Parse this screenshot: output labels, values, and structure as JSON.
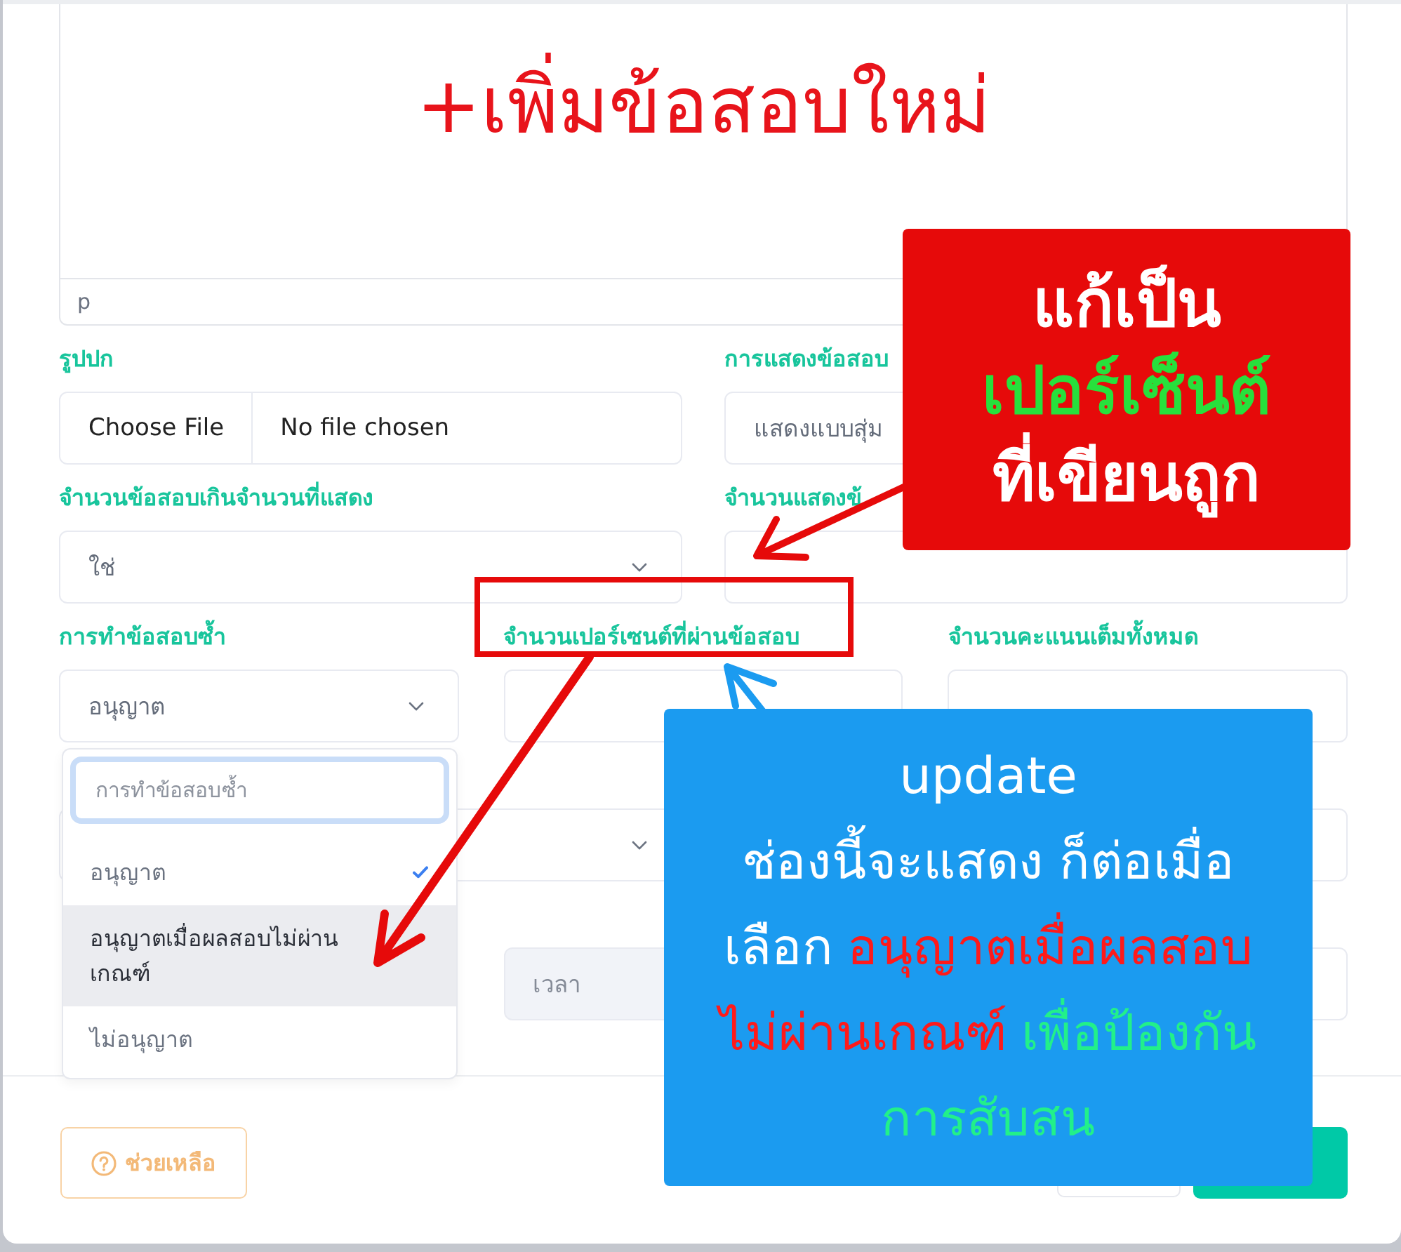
{
  "editor": {
    "heading": "+เพิ่มข้อสอบใหม่",
    "status_path": "p"
  },
  "form": {
    "rows": [
      {
        "fields": [
          {
            "kind": "file",
            "label": "รูปปก",
            "button": "Choose File",
            "value": "No file chosen"
          },
          {
            "kind": "input",
            "label": "การแสดงข้อสอบ",
            "value": "แสดงแบบสุ่ม",
            "disabled": false
          }
        ]
      },
      {
        "fields": [
          {
            "kind": "select",
            "label": "จำนวนข้อสอบเกินจำนวนที่แสดง",
            "value": "ใช่"
          },
          {
            "kind": "input",
            "label": "จำนวนแสดงข้",
            "disabled": false
          }
        ]
      },
      {
        "fields": [
          {
            "kind": "select",
            "label": "การทำข้อสอบซ้ำ",
            "value": "อนุญาต",
            "dropdown": {
              "search_placeholder": "การทำข้อสอบซ้ำ",
              "options": [
                {
                  "label": "อนุญาต",
                  "selected": true,
                  "hovered": false
                },
                {
                  "label": "อนุญาตเมื่อผลสอบไม่ผ่านเกณฑ์",
                  "selected": false,
                  "hovered": true
                },
                {
                  "label": "ไม่อนุญาต",
                  "selected": false,
                  "hovered": false
                }
              ]
            }
          },
          {
            "kind": "input",
            "label": "จำนวนเปอร์เซนต์ที่ผ่านข้อสอบ",
            "disabled": false
          },
          {
            "kind": "input",
            "label": "จำนวนคะแนนเต็มทั้งหมด",
            "disabled": false
          }
        ]
      },
      {
        "fields": [
          {
            "kind": "select"
          },
          {
            "kind": "input",
            "disabled": false
          }
        ]
      },
      {
        "fields": [
          {
            "kind": "input",
            "placeholder": "เวลา",
            "disabled": true
          },
          {
            "kind": "input",
            "disabled": false
          }
        ]
      }
    ]
  },
  "footer": {
    "help_button": "ช่วยเหลือ"
  },
  "callouts": [
    {
      "kind": "fix_note",
      "lines": [
        [
          {
            "text": "แก้เป็น",
            "color": "#ffffff"
          }
        ],
        [
          {
            "text": "เปอร์เซ็นต์",
            "color": "#27e03c"
          }
        ],
        [
          {
            "text": "ที่เขียนถูก",
            "color": "#ffffff"
          }
        ]
      ]
    },
    {
      "kind": "info_note",
      "lines": [
        [
          {
            "text": "update",
            "color": "#ffffff"
          }
        ],
        [
          {
            "text": "ช่องนี้จะแสดง ก็ต่อเมื่อ",
            "color": "#ffffff"
          }
        ],
        [
          {
            "text": "เลือก",
            "color": "#ffffff"
          },
          {
            "text": "อนุญาตเมื่อผลสอบ",
            "color": "#ff1a1a"
          }
        ],
        [
          {
            "text": "ไม่ผ่านเกณฑ์",
            "color": "#ff1a1a"
          },
          {
            "text": "เพื่อป้องกัน",
            "color": "#22f08a"
          }
        ],
        [
          {
            "text": "การสับสน",
            "color": "#22f08a"
          }
        ]
      ]
    }
  ]
}
